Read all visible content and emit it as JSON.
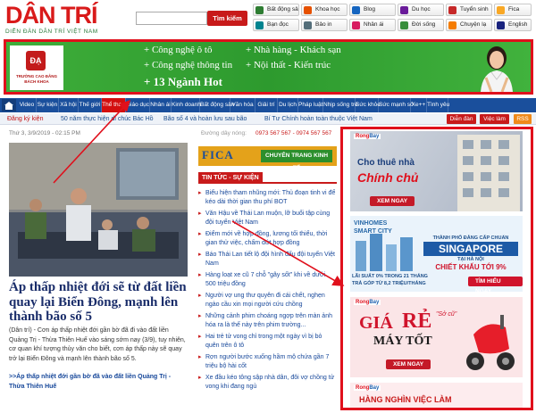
{
  "header": {
    "logo": "DÂN TRÍ",
    "logo_sub": "DIỄN ĐÀN DÂN TRÍ VIỆT NAM",
    "search_placeholder": "",
    "search_button": "Tìm kiếm",
    "quick_links": [
      {
        "label": "Bất động sản",
        "icon": "house-icon",
        "color": "#2e7d32"
      },
      {
        "label": "Khoa học",
        "icon": "atom-icon",
        "color": "#e65100"
      },
      {
        "label": "Blog",
        "icon": "blog-icon",
        "color": "#1565c0"
      },
      {
        "label": "Du học",
        "icon": "graduation-icon",
        "color": "#6a1b9a"
      },
      {
        "label": "Tuyển sinh",
        "icon": "student-icon",
        "color": "#c62828"
      },
      {
        "label": "Fica",
        "icon": "fica-icon",
        "color": "#f9a825"
      },
      {
        "label": "Bạn đọc",
        "icon": "reader-icon",
        "color": "#00838f"
      },
      {
        "label": "Bảo in",
        "icon": "print-icon",
        "color": "#546e7a"
      },
      {
        "label": "Nhân ái",
        "icon": "heart-icon",
        "color": "#d81b60"
      },
      {
        "label": "Đời sống",
        "icon": "life-icon",
        "color": "#388e3c"
      },
      {
        "label": "Chuyện lạ",
        "icon": "star-icon",
        "color": "#f57c00"
      },
      {
        "label": "English",
        "icon": "flag-uk-icon",
        "color": "#1a237e"
      }
    ]
  },
  "banner": {
    "logo_mark": "ĐẠ",
    "logo_text": "TRƯỜNG CAO ĐẲNG BÁCH KHOA",
    "lines": [
      "+ Công nghệ ô tô",
      "+ Nhà hàng - Khách sạn",
      "+ Công nghệ thông tin",
      "+ Nội thất - Kiến trúc"
    ],
    "hot": "+ 13 Ngành Hot"
  },
  "nav": {
    "items": [
      "Video",
      "Sự kiện",
      "Xã hội",
      "Thế giới",
      "Thể thao",
      "Giáo dục",
      "Nhân ái",
      "Kinh doanh",
      "Bất động sản",
      "Văn hóa",
      "Giải trí",
      "Du lịch",
      "Pháp luật",
      "Nhịp sống trẻ",
      "Sức khỏe",
      "Sức mạnh số",
      "Xe++",
      "Tình yêu"
    ],
    "active_index": 4
  },
  "ticker": {
    "user": "Đăng ký kiện",
    "items": [
      "50 năm thực hiện di chúc Bác Hồ",
      "Bão số 4 và hoàn lưu sau bão",
      "Bí Tư Chính hoàn toàn thuộc Việt Nam"
    ],
    "buttons": [
      "Diễn đàn",
      "Việc làm",
      "RSS"
    ]
  },
  "article": {
    "date": "Thứ 3, 3/9/2019 - 02:15 PM",
    "title": "Áp thấp nhiệt đới sẽ từ đất liền quay lại Biển Đông, mạnh lên thành bão số 5",
    "summary": "(Dân trí) - Cơn áp thấp nhiệt đới gần bờ đã đi vào đất liền Quảng Trị - Thừa Thiên Huế vào sáng sớm nay (3/9), tuy nhiên, cơ quan khí tượng thủy văn cho biết, cơn áp thấp này sẽ quay trở lại Biển Đông và mạnh lên thành bão số 5.",
    "related": ">>Áp thấp nhiệt đới gần bờ đã vào đất liền Quảng Trị - Thừa Thiên Huế"
  },
  "middle": {
    "hotline_label": "Đường dây nóng:",
    "hotline": "0973 567 567 - 0974 567 567",
    "fica_logo": "FICA",
    "fica_tag": "CHUYÊN TRANG KINH TẾ",
    "section_title": "TIN TỨC - SỰ KIỆN",
    "news": [
      "Biểu hiện tham nhũng mới: Thủ đoạn tinh vi để kéo dài thời gian thu phí BOT",
      "Văn Hậu về Thái Lan muộn, lỡ buổi tập cùng đội tuyển Việt Nam",
      "Điểm mới về hợp đồng, lương tối thiểu, thời gian thử việc, chấm dứt hợp đồng",
      "Báo Thái Lan tiết lộ đội hình đấu đội tuyển Việt Nam",
      "Hàng loạt xe cũ 7 chỗ \"gây sốt\" khi về dưới 500 triệu đồng",
      "Người vợ ung thư quyên đi cái chết, nghẹn ngào cầu xin mọi người cứu chồng",
      "Những cảnh phim choáng ngợp trên màn ảnh hóa ra là thế này trên phim trường...",
      "Hai trẻ tử vong chỉ trong một ngày vì bị bỏ quên trên ô tô",
      "Rợn người bước xuống hầm mộ chứa gần 7 triệu bộ hài cốt",
      "Xe đầu kéo tông sập nhà dân, đôi vợ chồng tử vong khi đang ngủ"
    ]
  },
  "ads": {
    "brand": [
      "Rong",
      "Bay"
    ],
    "ad1": {
      "title": "Cho thuê nhà",
      "title2": "Chính chủ",
      "button": "XEM NGAY"
    },
    "ad2": {
      "brand": "VINHOMES SMART CITY",
      "subtitle": "THÀNH PHỐ ĐẲNG CẤP CHUẨN",
      "city": "SINGAPORE",
      "tagline": "TẠI HÀ NỘI",
      "discount": "CHIẾT KHẤU TỚI 9%",
      "loan": "LÃI SUẤT 0% TRONG 21 THÁNG",
      "pay": "TRẢ GÓP TỪ 8,2 TRIỆU/THÁNG",
      "button": "TÌM HIỂU NGAY"
    },
    "ad3": {
      "price_word": "GIÁ",
      "price_word2": "RẺ",
      "tagline": "MÁY TỐT",
      "note": "\"Sở cũ\"",
      "button": "XEM NGAY"
    },
    "ad4": {
      "title": "HÀNG NGHÌN VIỆC LÀM"
    }
  }
}
